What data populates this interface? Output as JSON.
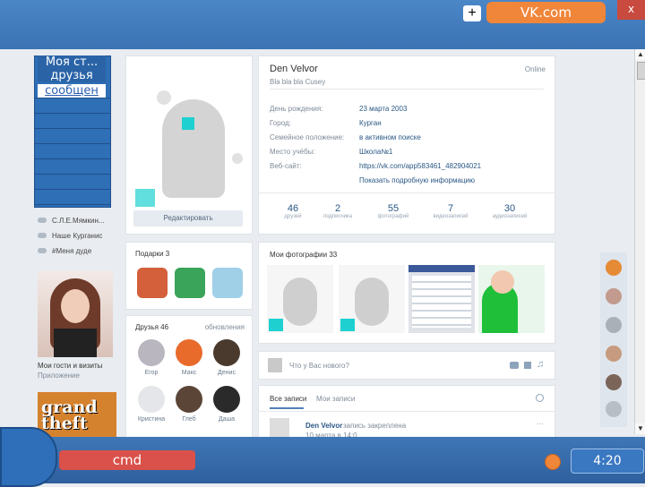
{
  "window": {
    "title": "VK.com",
    "plus": "+",
    "close": "x"
  },
  "side_panel": {
    "title_line1": "Моя ст...",
    "title_line2": "друзья",
    "link": "сообщен"
  },
  "left_links": [
    "С.Л.Е.Мямкин...",
    "Наше Курганис",
    "#Меня дуде"
  ],
  "profile_left": {
    "edit_button": "Редактировать",
    "promo_caption_1": "Мои гости и визиты",
    "promo_caption_2": "Приложение",
    "game_title": "grand theft"
  },
  "profile": {
    "name": "Den Velvor",
    "status": "Bla bla bla Cusey",
    "online": "Online",
    "fields": [
      {
        "label": "День рождения:",
        "value": "23 марта 2003"
      },
      {
        "label": "Город:",
        "value": "Курган"
      },
      {
        "label": "Семейное положение:",
        "value": "в активном поиске"
      },
      {
        "label": "Место учёбы:",
        "value": "Школа№1"
      },
      {
        "label": "Веб-сайт:",
        "value": "https://vk.com/app583461_482904021"
      }
    ],
    "show_more": "Показать подробную информацию",
    "stats": [
      {
        "n": "46",
        "l": "друзей"
      },
      {
        "n": "2",
        "l": "подписчика"
      },
      {
        "n": "55",
        "l": "фотографий"
      },
      {
        "n": "7",
        "l": "видеозаписей"
      },
      {
        "n": "30",
        "l": "аудиозаписей"
      }
    ]
  },
  "gifts": {
    "title": "Подарки 3"
  },
  "friends": {
    "title": "Друзья 46",
    "update": "обновления",
    "names": [
      "Егор",
      "Макс",
      "Денис",
      "Кристина",
      "Глеб",
      "Даша"
    ]
  },
  "photos": {
    "title": "Мои фотографии 33"
  },
  "post_box": {
    "placeholder": "Что у Вас нового?"
  },
  "wall": {
    "tab_all": "Все записи",
    "tab_mine": "Мои записи",
    "author": "Den Velvor",
    "action": "запись закреплена",
    "time": "10 марта в 14:0"
  },
  "taskbar": {
    "cmd": "cmd",
    "clock": "4:20"
  },
  "scroll": {
    "up": "▲",
    "down": "▼"
  }
}
